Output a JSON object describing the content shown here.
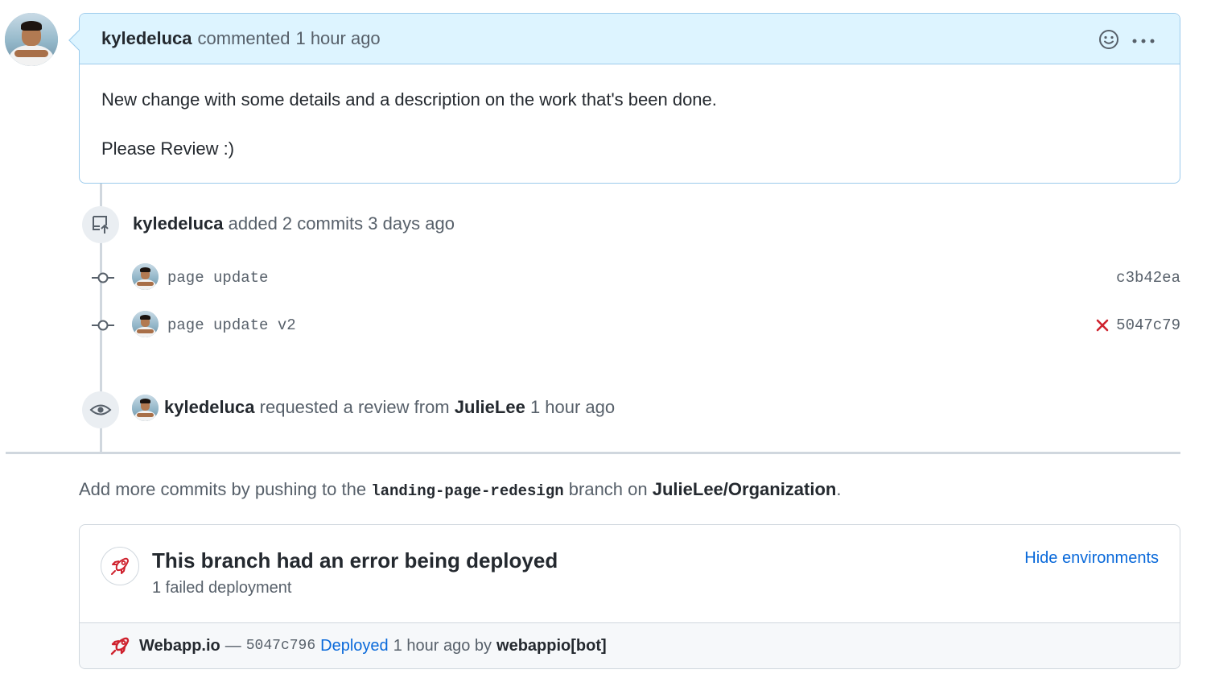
{
  "comment": {
    "author": "kyledeluca",
    "action": "commented",
    "time": "1 hour ago",
    "body_line1": "New change with some details and a description on the work that's been done.",
    "body_line2": "Please Review :)",
    "icons": [
      "smiley-icon",
      "kebab-menu-icon"
    ]
  },
  "commits_event": {
    "author": "kyledeluca",
    "text": "added 2 commits",
    "time": "3 days ago",
    "commits": [
      {
        "message": "page update",
        "sha": "c3b42ea",
        "status": ""
      },
      {
        "message": "page update v2",
        "sha": "5047c79",
        "status": "failed"
      }
    ]
  },
  "review_event": {
    "author": "kyledeluca",
    "text": "requested a review from",
    "reviewer": "JulieLee",
    "time": "1 hour ago"
  },
  "hint": {
    "prefix": "Add more commits by pushing to the",
    "branch": "landing-page-redesign",
    "middle": "branch on",
    "repo": "JulieLee/Organization",
    "suffix": "."
  },
  "deployment": {
    "title": "This branch had an error being deployed",
    "subtitle": "1 failed deployment",
    "hide_link": "Hide environments",
    "environment": "Webapp.io",
    "dash": "—",
    "sha": "5047c796",
    "status_link": "Deployed",
    "time": "1 hour ago by",
    "bot": "webappio[bot]"
  },
  "colors": {
    "header_bg": "#ddf4ff",
    "link": "#0969da",
    "error": "#cf222e"
  }
}
